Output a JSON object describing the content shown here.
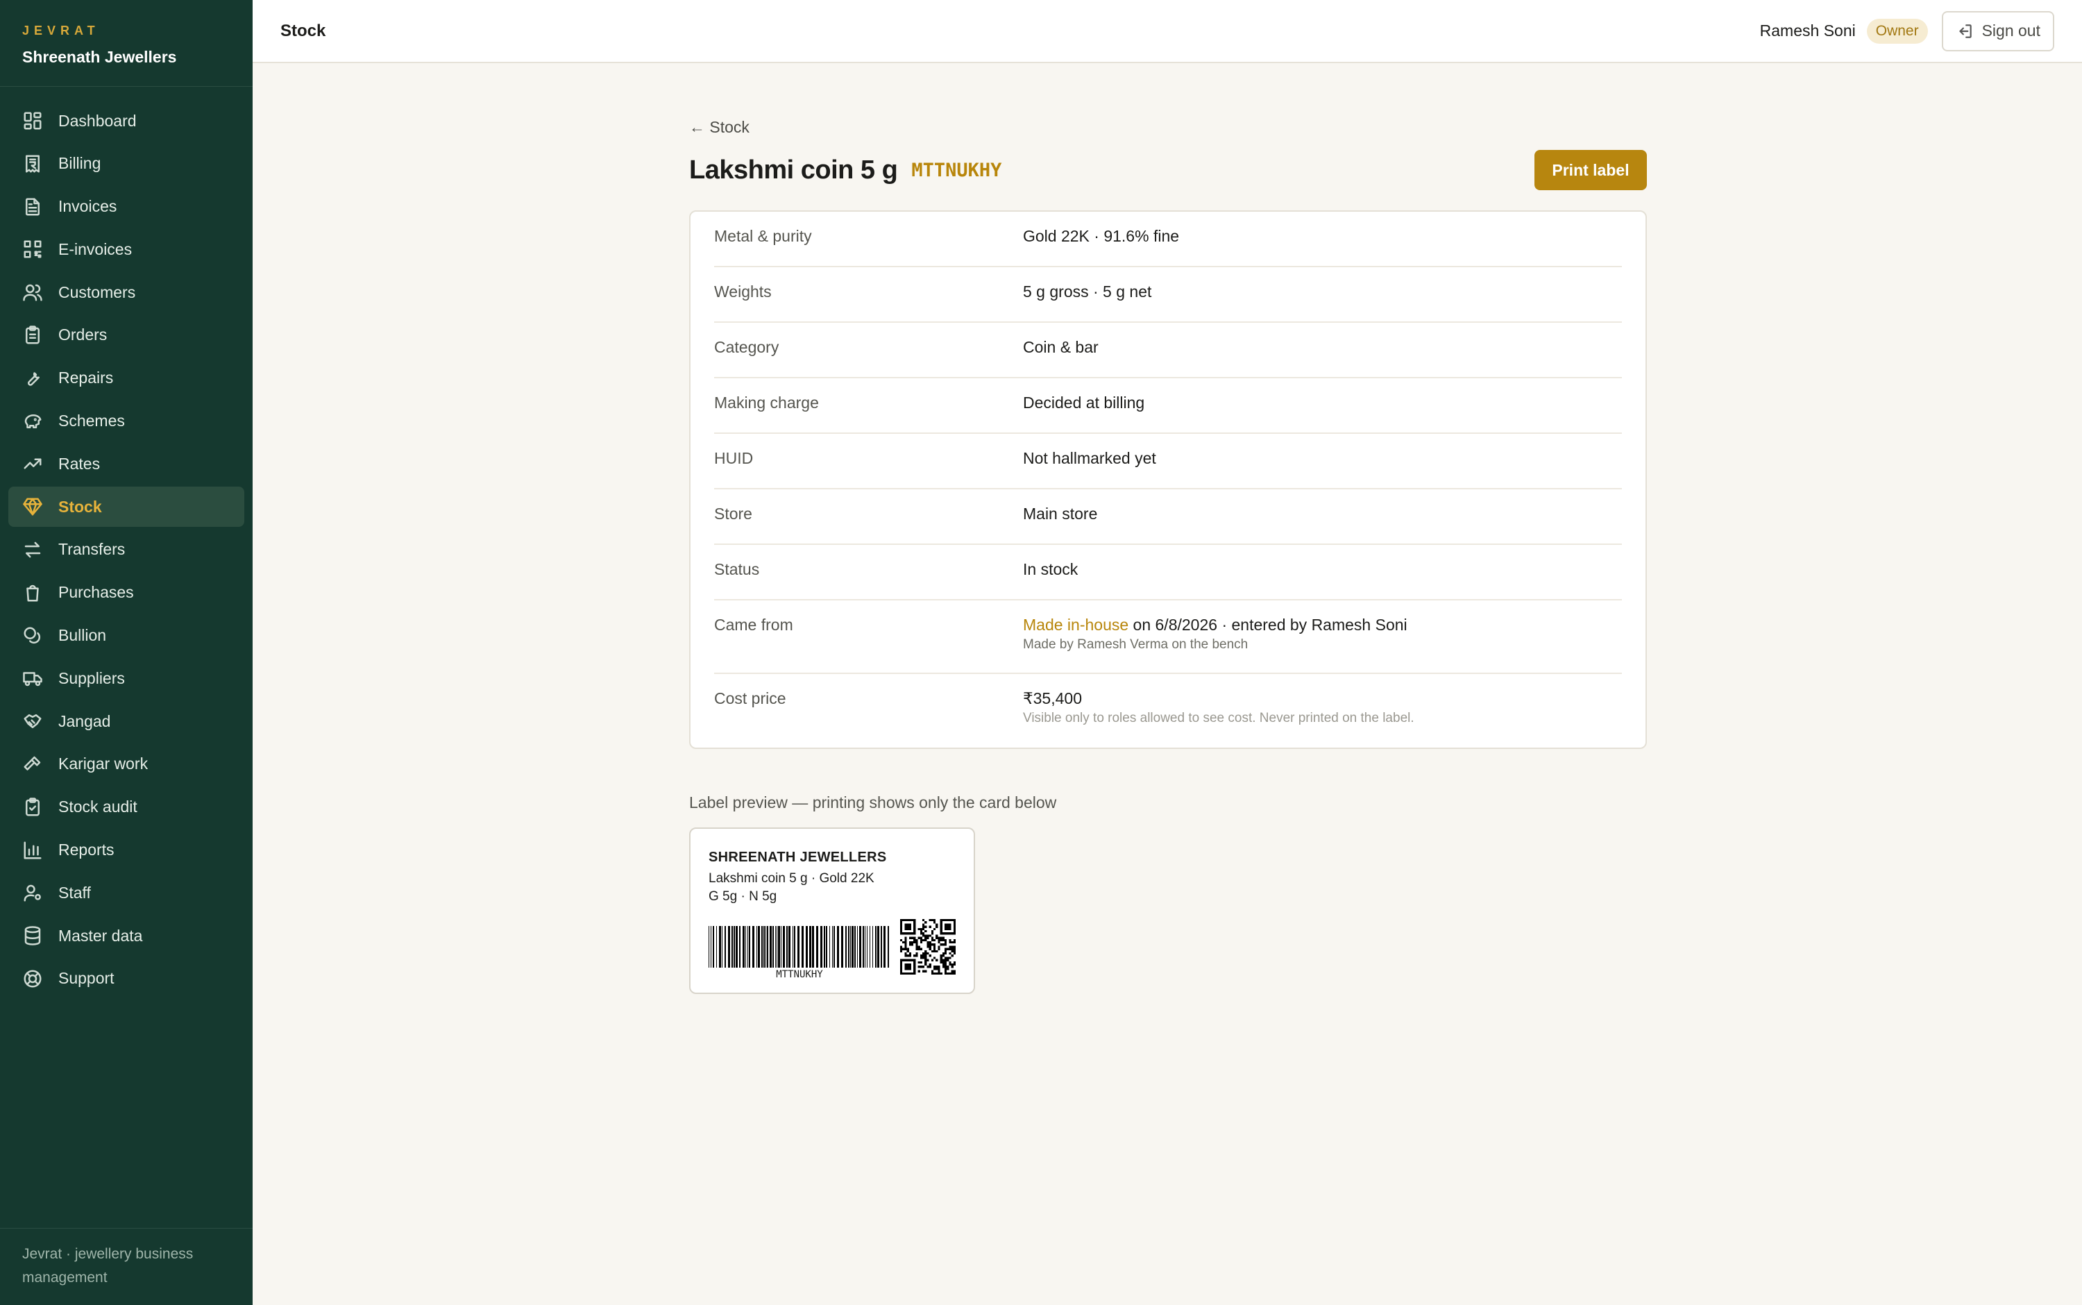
{
  "brand": {
    "kicker": "JEVRAT",
    "name": "Shreenath Jewellers"
  },
  "sidebar": {
    "items": [
      {
        "label": "Dashboard",
        "icon": "dashboard-icon"
      },
      {
        "label": "Billing",
        "icon": "rupee-receipt-icon"
      },
      {
        "label": "Invoices",
        "icon": "document-icon"
      },
      {
        "label": "E-invoices",
        "icon": "qr-grid-icon"
      },
      {
        "label": "Customers",
        "icon": "users-icon"
      },
      {
        "label": "Orders",
        "icon": "clipboard-icon"
      },
      {
        "label": "Repairs",
        "icon": "wrench-icon"
      },
      {
        "label": "Schemes",
        "icon": "piggy-bank-icon"
      },
      {
        "label": "Rates",
        "icon": "trend-up-icon"
      },
      {
        "label": "Stock",
        "icon": "gem-icon",
        "active": true
      },
      {
        "label": "Transfers",
        "icon": "arrows-swap-icon"
      },
      {
        "label": "Purchases",
        "icon": "shopping-bag-icon"
      },
      {
        "label": "Bullion",
        "icon": "coins-icon"
      },
      {
        "label": "Suppliers",
        "icon": "truck-icon"
      },
      {
        "label": "Jangad",
        "icon": "handshake-icon"
      },
      {
        "label": "Karigar work",
        "icon": "hammer-icon"
      },
      {
        "label": "Stock audit",
        "icon": "clipboard-check-icon"
      },
      {
        "label": "Reports",
        "icon": "bar-chart-icon"
      },
      {
        "label": "Staff",
        "icon": "user-cog-icon"
      },
      {
        "label": "Master data",
        "icon": "database-icon"
      },
      {
        "label": "Support",
        "icon": "lifebuoy-icon"
      }
    ],
    "footer": "Jevrat · jewellery business management"
  },
  "topbar": {
    "title": "Stock",
    "user_name": "Ramesh Soni",
    "role": "Owner",
    "signout_label": "Sign out"
  },
  "main": {
    "back_label": "← Stock",
    "title": "Lakshmi coin 5 g",
    "sku": "MTTNUKHY",
    "print_label": "Print label",
    "details": [
      {
        "label": "Metal & purity",
        "value": "Gold 22K · 91.6% fine"
      },
      {
        "label": "Weights",
        "value": "5 g gross · 5 g net"
      },
      {
        "label": "Category",
        "value": "Coin & bar"
      },
      {
        "label": "Making charge",
        "value": "Decided at billing"
      },
      {
        "label": "HUID",
        "value": "Not hallmarked yet"
      },
      {
        "label": "Store",
        "value": "Main store"
      },
      {
        "label": "Status",
        "value": "In stock"
      }
    ],
    "came_from": {
      "label": "Came from",
      "source": "Made in-house",
      "rest": " on 6/8/2026 · entered by Ramesh Soni",
      "sub": "Made by Ramesh Verma on the bench"
    },
    "cost": {
      "label": "Cost price",
      "value": "₹35,400",
      "sub": "Visible only to roles allowed to see cost. Never printed on the label."
    },
    "label_preview": {
      "caption": "Label preview — printing shows only the card below",
      "shop": "SHREENATH JEWELLERS",
      "line1": "Lakshmi coin 5 g · Gold 22K",
      "line2": "G 5g · N 5g",
      "barcode_text": "MTTNUKHY"
    }
  },
  "colors": {
    "sidebar": "#15392f",
    "accent": "#b8860b",
    "active_text": "#e7b33b"
  }
}
